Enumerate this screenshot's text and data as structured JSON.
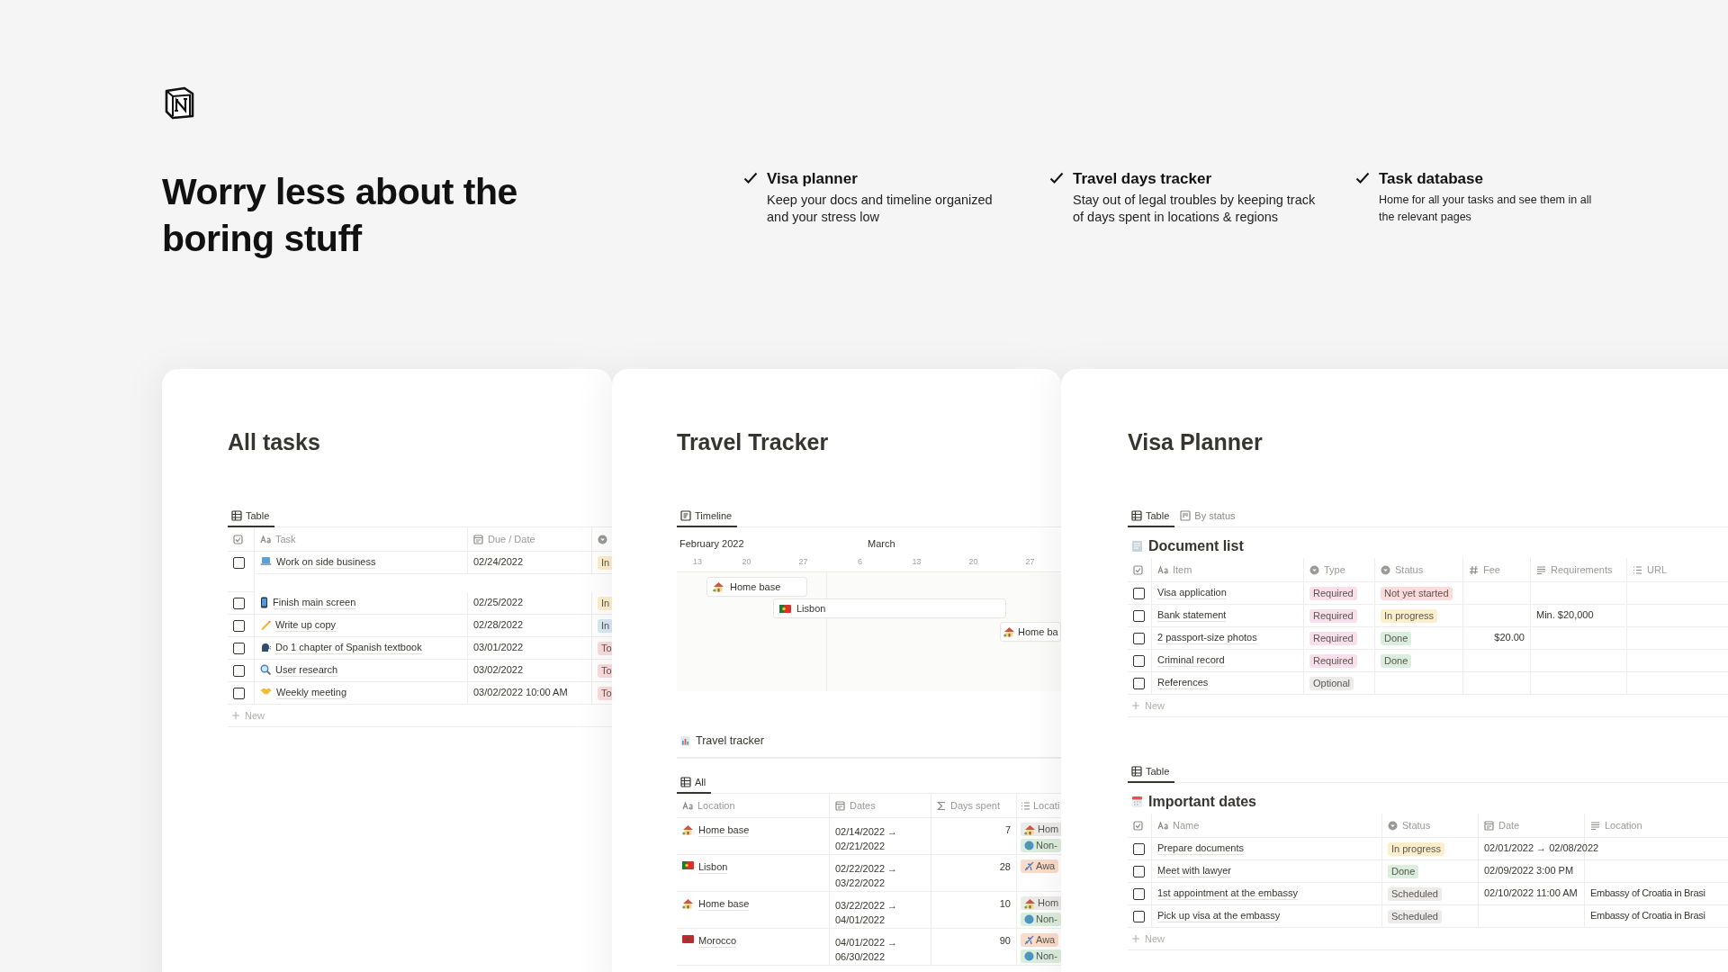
{
  "hero": {
    "title": "Worry less about the boring stuff"
  },
  "features": [
    {
      "title": "Visa planner",
      "description": "Keep your docs and timeline organized and your stress low"
    },
    {
      "title": "Travel days tracker",
      "description": "Stay out of legal troubles by keeping track of days spent in locations & regions"
    },
    {
      "title": "Task database",
      "description": "Home for all your tasks and see them in all the relevant pages"
    }
  ],
  "all_tasks": {
    "title": "All tasks",
    "views": [
      {
        "label": "Table",
        "selected": true
      }
    ],
    "columns": [
      "Task",
      "Due / Date"
    ],
    "rows": [
      {
        "task": "Work on side business",
        "due": "02/24/2022",
        "checked": false,
        "status": {
          "label": "In",
          "color": "#fbeecb"
        }
      },
      {
        "task": "Finish main screen",
        "due": "02/25/2022",
        "checked": false,
        "status": {
          "label": "In",
          "color": "#fbeecb"
        }
      },
      {
        "task": "Write up copy",
        "due": "02/28/2022",
        "checked": false,
        "status": {
          "label": "In",
          "color": "#d8e8f2"
        }
      },
      {
        "task": "Do 1 chapter of Spanish textbook",
        "due": "03/01/2022",
        "checked": false,
        "status": {
          "label": "To",
          "color": "#fbdcdc"
        }
      },
      {
        "task": "User research",
        "due": "03/02/2022",
        "checked": false,
        "status": {
          "label": "To",
          "color": "#fbdcdc"
        }
      },
      {
        "task": "Weekly meeting",
        "due": "03/02/2022 10:00 AM",
        "checked": false,
        "status": {
          "label": "To",
          "color": "#fbdcdc"
        }
      }
    ],
    "new_label": "New"
  },
  "travel_tracker": {
    "title": "Travel Tracker",
    "views": [
      {
        "label": "Timeline",
        "selected": true
      }
    ],
    "timeline": {
      "months": [
        "February 2022",
        "March"
      ],
      "ticks": [
        "13",
        "20",
        "27",
        "6",
        "13",
        "20",
        "27"
      ],
      "bars": [
        {
          "label": "Home base"
        },
        {
          "label": "Lisbon"
        },
        {
          "label": "Home ba"
        }
      ]
    },
    "section": {
      "title": "Travel tracker",
      "views": [
        {
          "label": "All",
          "selected": true
        }
      ],
      "columns": [
        "Location",
        "Dates",
        "Days spent",
        "Locati"
      ],
      "rows": [
        {
          "location": "Home base",
          "dates": "02/14/2022 → 02/21/2022",
          "days": "7",
          "tags": [
            {
              "label": "Hom",
              "color": "#ecebea"
            },
            {
              "label": "Non-",
              "color": "#dbeddd"
            }
          ]
        },
        {
          "location": "Lisbon",
          "dates": "02/22/2022 → 03/22/2022",
          "days": "28",
          "tags": [
            {
              "label": "Awa",
              "color": "#fadcc9"
            }
          ]
        },
        {
          "location": "Home base",
          "dates": "03/22/2022 → 04/01/2022",
          "days": "10",
          "tags": [
            {
              "label": "Hom",
              "color": "#ecebea"
            },
            {
              "label": "Non-",
              "color": "#dbeddd"
            }
          ]
        },
        {
          "location": "Morocco",
          "dates": "04/01/2022 → 06/30/2022",
          "days": "90",
          "tags": [
            {
              "label": "Awa",
              "color": "#fadcc9"
            },
            {
              "label": "Non-",
              "color": "#dbeddd"
            }
          ]
        }
      ]
    }
  },
  "visa_planner": {
    "title": "Visa Planner",
    "views": [
      {
        "label": "Table",
        "selected": true
      },
      {
        "label": "By status",
        "selected": false
      }
    ],
    "documents": {
      "title": "Document list",
      "columns": [
        "Item",
        "Type",
        "Status",
        "Fee",
        "Requirements",
        "URL"
      ],
      "rows": [
        {
          "item": "Visa application",
          "checked": false,
          "type": {
            "label": "Required",
            "color": "#f9dfe9"
          },
          "status": {
            "label": "Not yet started",
            "color": "#fbdcdc"
          }
        },
        {
          "item": "Bank statement",
          "checked": false,
          "type": {
            "label": "Required",
            "color": "#f9dfe9"
          },
          "status": {
            "label": "In progress",
            "color": "#fbeecb"
          },
          "requirements": "Min. $20,000"
        },
        {
          "item": "2 passport-size photos",
          "checked": false,
          "type": {
            "label": "Required",
            "color": "#f9dfe9"
          },
          "status": {
            "label": "Done",
            "color": "#dbeddd"
          },
          "fee": "$20.00"
        },
        {
          "item": "Criminal record",
          "checked": false,
          "type": {
            "label": "Required",
            "color": "#f9dfe9"
          },
          "status": {
            "label": "Done",
            "color": "#dbeddd"
          }
        },
        {
          "item": "References",
          "checked": false,
          "type": {
            "label": "Optional",
            "color": "#ecebea"
          }
        }
      ],
      "new_label": "New"
    },
    "dates": {
      "views": [
        {
          "label": "Table",
          "selected": true
        }
      ],
      "title": "Important dates",
      "columns": [
        "Name",
        "Status",
        "Date",
        "Location"
      ],
      "rows": [
        {
          "name": "Prepare documents",
          "checked": false,
          "status": {
            "label": "In progress",
            "color": "#fbeecb"
          },
          "date": "02/01/2022 → 02/08/2022"
        },
        {
          "name": "Meet with lawyer",
          "checked": false,
          "status": {
            "label": "Done",
            "color": "#dbeddd"
          },
          "date": "02/09/2022 3:00 PM"
        },
        {
          "name": "1st appointment at the embassy",
          "checked": false,
          "status": {
            "label": "Scheduled",
            "color": "#ecebea"
          },
          "date": "02/10/2022 11:00 AM",
          "location": "Embassy of Croatia in Brasi"
        },
        {
          "name": "Pick up visa at the embassy",
          "checked": false,
          "status": {
            "label": "Scheduled",
            "color": "#ecebea"
          },
          "location": "Embassy of Croatia in Brasi"
        }
      ],
      "new_label": "New"
    }
  }
}
